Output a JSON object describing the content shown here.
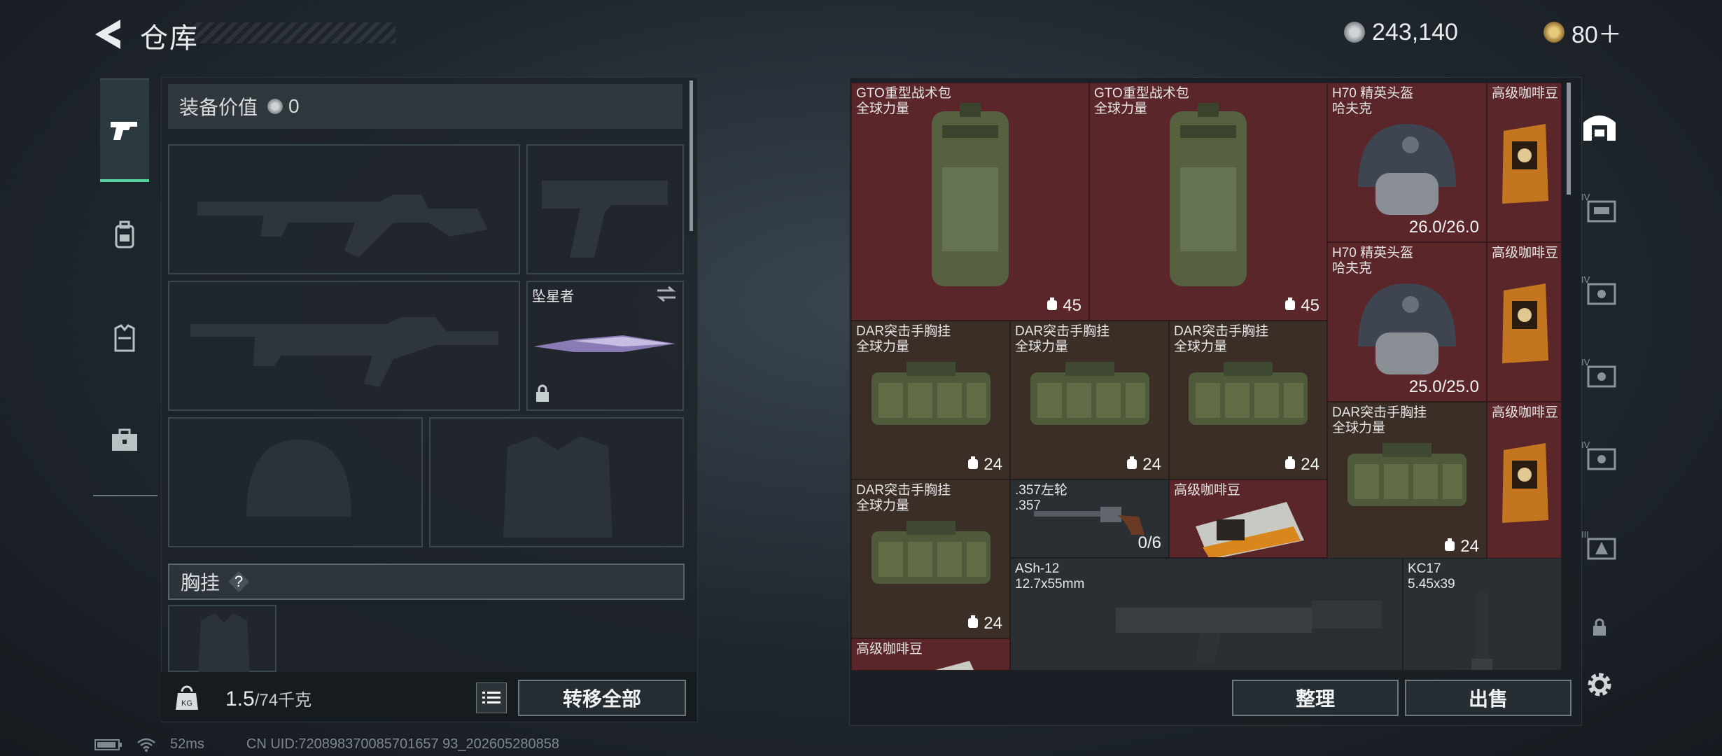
{
  "header": {
    "title": "仓库"
  },
  "currency": {
    "coins": "243,140",
    "tickets": "80＋"
  },
  "loadout": {
    "equip_value_label": "装备价值",
    "equip_value": "0",
    "stellar_slot_label": "坠星者",
    "chest_label": "胸挂",
    "chest_help": "?",
    "weight_current": "1.5",
    "weight_max": "/74千克",
    "transfer_all": "转移全部"
  },
  "inventory": {
    "items": [
      {
        "name": "GTO重型战术包",
        "brand": "全球力量",
        "count": "45",
        "color": "red"
      },
      {
        "name": "GTO重型战术包",
        "brand": "全球力量",
        "count": "45",
        "color": "red"
      },
      {
        "name": "H70 精英头盔",
        "brand": "哈夫克",
        "durability": "26.0/26.0",
        "color": "red"
      },
      {
        "name": "高级咖啡豆",
        "color": "red"
      },
      {
        "name": "H70 精英头盔",
        "brand": "哈夫克",
        "durability": "25.0/25.0",
        "color": "red"
      },
      {
        "name": "高级咖啡豆",
        "color": "red"
      },
      {
        "name": "DAR突击手胸挂",
        "brand": "全球力量",
        "count": "24",
        "color": "brown"
      },
      {
        "name": "DAR突击手胸挂",
        "brand": "全球力量",
        "count": "24",
        "color": "brown"
      },
      {
        "name": "DAR突击手胸挂",
        "brand": "全球力量",
        "count": "24",
        "color": "brown"
      },
      {
        "name": "DAR突击手胸挂",
        "brand": "全球力量",
        "count": "24",
        "color": "brown"
      },
      {
        "name": "高级咖啡豆",
        "color": "red"
      },
      {
        "name": "DAR突击手胸挂",
        "brand": "全球力量",
        "count": "24",
        "color": "brown"
      },
      {
        "name": ".357左轮",
        "caliber": ".357",
        "ammo": "0/6",
        "color": "dark"
      },
      {
        "name": "高级咖啡豆",
        "color": "red"
      },
      {
        "name": "ASh-12",
        "caliber": "12.7x55mm",
        "color": "dark"
      },
      {
        "name": "KC17",
        "caliber": "5.45x39",
        "color": "dark"
      },
      {
        "name": "高级咖啡豆",
        "color": "red"
      }
    ],
    "sort": "整理",
    "sell": "出售"
  },
  "status": {
    "ping": "52ms",
    "uid": "CN UID:720898370085701657 93_202605280858"
  }
}
